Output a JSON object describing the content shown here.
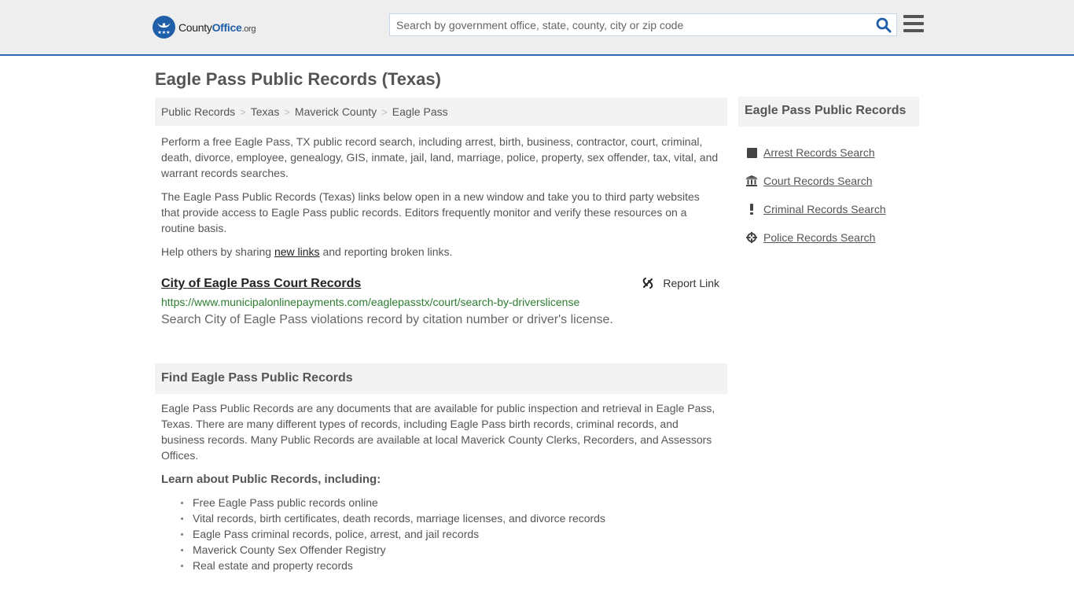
{
  "header": {
    "logo": {
      "brand_main": "County",
      "brand_accent": "Office",
      "brand_suffix": ".org"
    },
    "search": {
      "placeholder": "Search by government office, state, county, city or zip code",
      "value": ""
    },
    "search_icon": "search-icon",
    "menu_icon": "hamburger-menu-icon"
  },
  "page": {
    "title": "Eagle Pass Public Records (Texas)"
  },
  "breadcrumb": [
    {
      "label": "Public Records"
    },
    {
      "label": "Texas"
    },
    {
      "label": "Maverick County"
    },
    {
      "label": "Eagle Pass"
    }
  ],
  "intro": {
    "p1": "Perform a free Eagle Pass, TX public record search, including arrest, birth, business, contractor, court, criminal, death, divorce, employee, genealogy, GIS, inmate, jail, land, marriage, police, property, sex offender, tax, vital, and warrant records searches.",
    "p2": "The Eagle Pass Public Records (Texas) links below open in a new window and take you to third party websites that provide access to Eagle Pass public records. Editors frequently monitor and verify these resources on a routine basis.",
    "p3_before": "Help others by sharing ",
    "p3_link": "new links",
    "p3_after": " and reporting broken links."
  },
  "records": [
    {
      "title": "City of Eagle Pass Court Records",
      "url": "https://www.municipalonlinepayments.com/eaglepasstx/court/search-by-driverslicense",
      "description": "Search City of Eagle Pass violations record by citation number or driver's license.",
      "report_label": "Report Link"
    }
  ],
  "find_section": {
    "heading": "Find Eagle Pass Public Records",
    "body": "Eagle Pass Public Records are any documents that are available for public inspection and retrieval in Eagle Pass, Texas. There are many different types of records, including Eagle Pass birth records, criminal records, and business records. Many Public Records are available at local Maverick County Clerks, Recorders, and Assessors Offices.",
    "learn_heading": "Learn about Public Records, including:",
    "items": [
      "Free Eagle Pass public records online",
      "Vital records, birth certificates, death records, marriage licenses, and divorce records",
      "Eagle Pass criminal records, police, arrest, and jail records",
      "Maverick County Sex Offender Registry",
      "Real estate and property records"
    ]
  },
  "sidebar": {
    "heading": "Eagle Pass Public Records",
    "items": [
      {
        "label": "Arrest Records Search",
        "icon": "square-icon"
      },
      {
        "label": "Court Records Search",
        "icon": "courthouse-icon"
      },
      {
        "label": "Criminal Records Search",
        "icon": "exclamation-icon"
      },
      {
        "label": "Police Records Search",
        "icon": "crosshairs-icon"
      }
    ]
  },
  "colors": {
    "accent": "#1f5ea8",
    "header_border": "#2a6ab3",
    "url_green": "#2e7d32"
  }
}
